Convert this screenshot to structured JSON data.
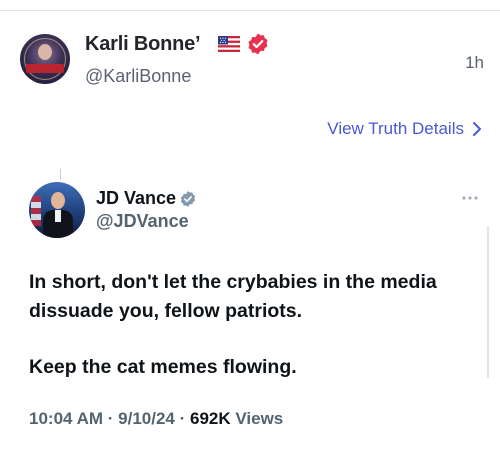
{
  "post": {
    "author_name": "Karli Bonne’",
    "author_handle": "@KarliBonne",
    "time": "1h",
    "flag_icon": "us-flag-icon",
    "verified_color": "#e8314f",
    "details_link": "View Truth Details",
    "link_color": "#4a58d8"
  },
  "embedded_tweet": {
    "name": "JD Vance",
    "handle": "@JDVance",
    "verified_color": "#829aab",
    "text_lines": [
      "In short, don't let the crybabies in the media",
      "dissuade you, fellow patriots.",
      "Keep the cat memes flowing."
    ],
    "time": "10:04 AM",
    "date": "9/10/24",
    "views_count": "692K",
    "views_label": "Views"
  }
}
